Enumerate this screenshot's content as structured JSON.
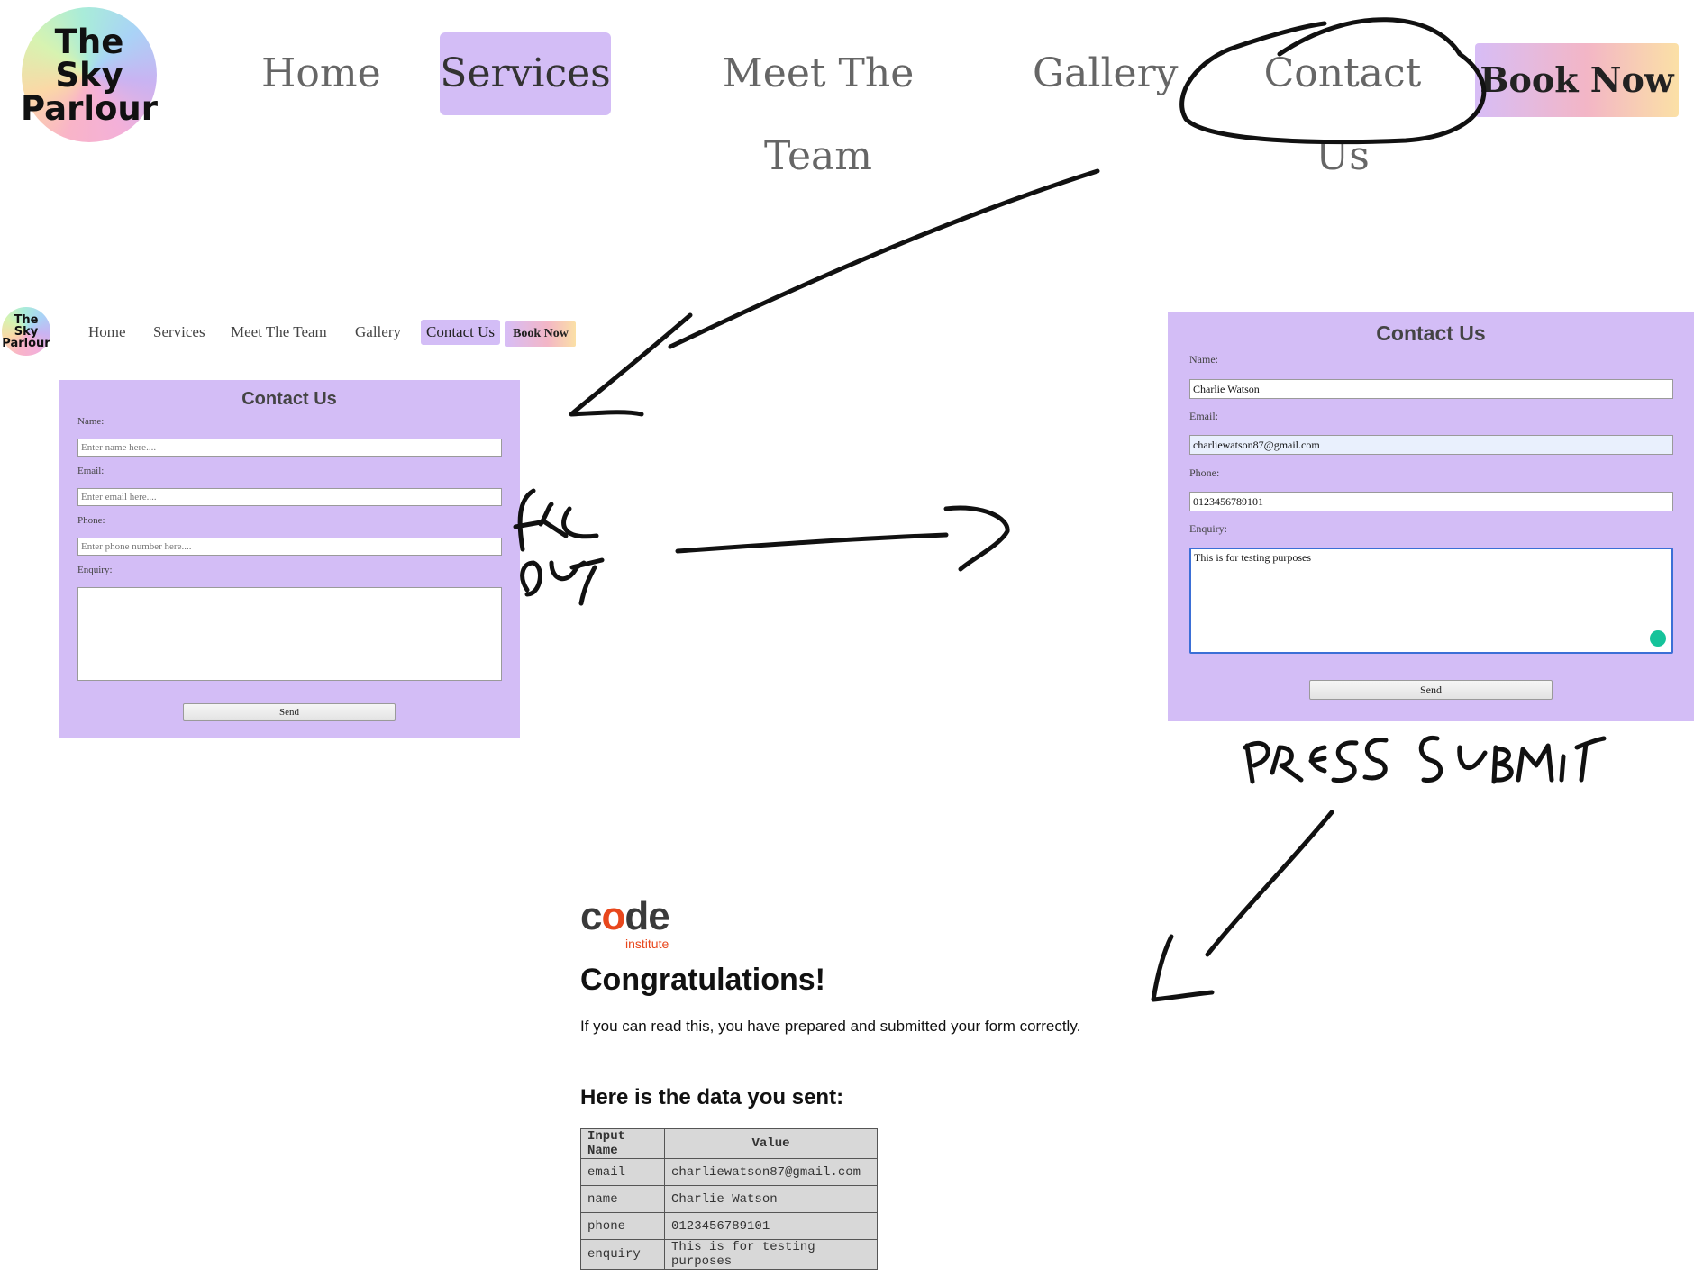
{
  "big_header": {
    "logo": {
      "line1": "The Sky",
      "line2": "Parlour"
    },
    "nav": [
      {
        "label": "Home",
        "active": false
      },
      {
        "label": "Services",
        "active": true
      },
      {
        "label": "Meet The Team",
        "active": false
      },
      {
        "label": "Gallery",
        "active": false
      },
      {
        "label": "Contact Us",
        "active": false,
        "circled": true
      }
    ],
    "book_now": "Book Now"
  },
  "small_header": {
    "logo": {
      "line1": "The Sky",
      "line2": "Parlour"
    },
    "nav": [
      {
        "label": "Home",
        "active": false
      },
      {
        "label": "Services",
        "active": false
      },
      {
        "label": "Meet The Team",
        "active": false
      },
      {
        "label": "Gallery",
        "active": false
      },
      {
        "label": "Contact Us",
        "active": true
      }
    ],
    "book_now": "Book Now"
  },
  "empty_form": {
    "title": "Contact Us",
    "name_label": "Name:",
    "name_placeholder": "Enter name here....",
    "email_label": "Email:",
    "email_placeholder": "Enter email here....",
    "phone_label": "Phone:",
    "phone_placeholder": "Enter phone number here....",
    "enquiry_label": "Enquiry:",
    "send_label": "Send"
  },
  "filled_form": {
    "title": "Contact Us",
    "name_label": "Name:",
    "name_value": "Charlie Watson",
    "email_label": "Email:",
    "email_value": "charliewatson87@gmail.com",
    "phone_label": "Phone:",
    "phone_value": "0123456789101",
    "enquiry_label": "Enquiry:",
    "enquiry_value": "This is for testing purposes",
    "send_label": "Send"
  },
  "annotations": {
    "fill_out": "FILL OUT",
    "press_submit": "PRESS SUBMIT",
    "ink_color": "#111111"
  },
  "result": {
    "logo_word": "code",
    "logo_sub": "institute",
    "accent": "#e8471c",
    "title": "Congratulations!",
    "message": "If you can read this, you have prepared and submitted your form correctly.",
    "data_heading": "Here is the data you sent:",
    "table": {
      "headers": [
        "Input Name",
        "Value"
      ],
      "rows": [
        [
          "email",
          "charliewatson87@gmail.com"
        ],
        [
          "name",
          "Charlie Watson"
        ],
        [
          "phone",
          "0123456789101"
        ],
        [
          "enquiry",
          "This is for testing purposes"
        ]
      ]
    }
  },
  "colors": {
    "lavender": "#d3bdf6"
  }
}
